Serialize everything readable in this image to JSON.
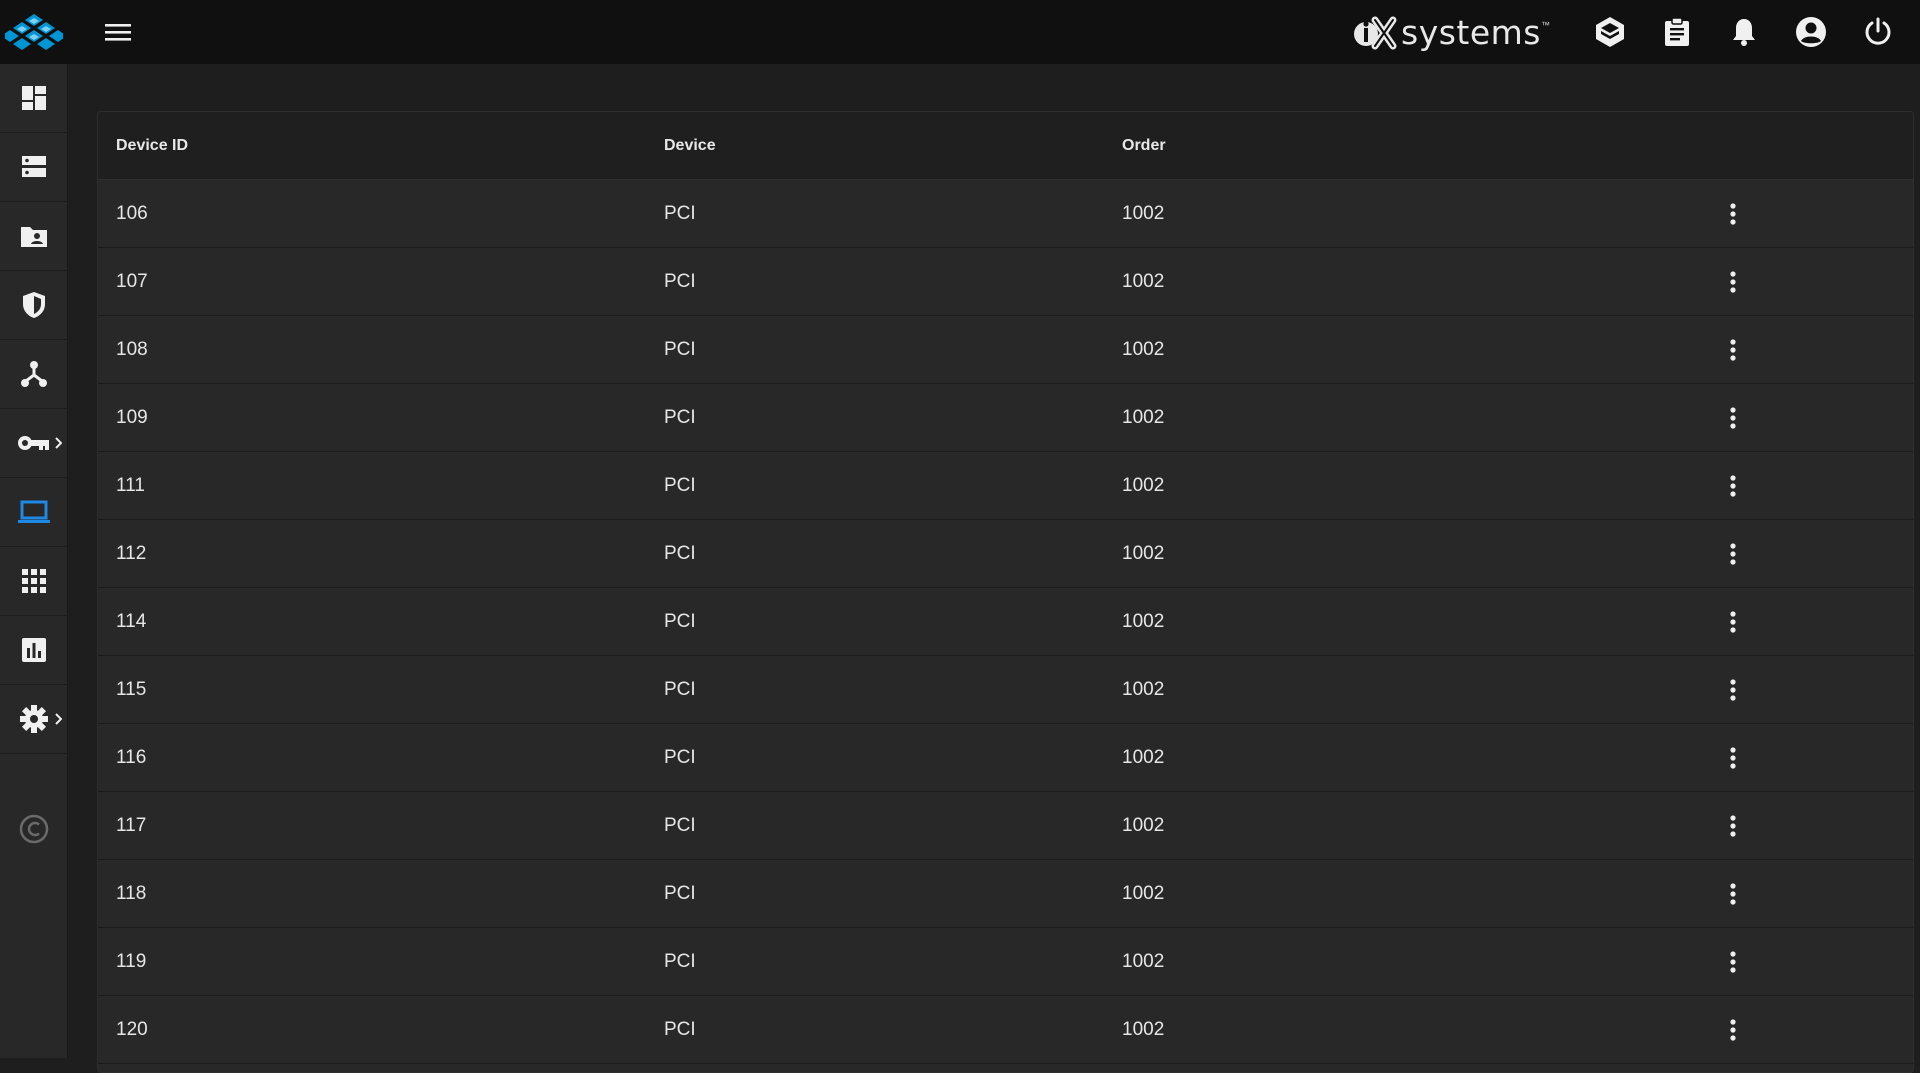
{
  "app": {
    "brand": "systems",
    "brand_tm": "™"
  },
  "colors": {
    "accent": "#1e88e5",
    "logo": "#0095d5"
  },
  "topbar": {
    "icons": [
      "truecommand-icon",
      "tasks-icon",
      "bell-icon",
      "account-icon",
      "power-icon"
    ]
  },
  "sidebar": {
    "items": [
      {
        "icon": "dashboard-icon",
        "active": false,
        "expandable": false
      },
      {
        "icon": "storage-icon",
        "active": false,
        "expandable": false
      },
      {
        "icon": "shares-icon",
        "active": false,
        "expandable": false
      },
      {
        "icon": "shield-icon",
        "active": false,
        "expandable": false
      },
      {
        "icon": "network-icon",
        "active": false,
        "expandable": false
      },
      {
        "icon": "key-icon",
        "active": false,
        "expandable": true
      },
      {
        "icon": "laptop-icon",
        "active": true,
        "expandable": false
      },
      {
        "icon": "apps-grid-icon",
        "active": false,
        "expandable": false
      },
      {
        "icon": "reporting-icon",
        "active": false,
        "expandable": false
      },
      {
        "icon": "gear-icon",
        "active": false,
        "expandable": true
      }
    ],
    "footer_icon": "copyright-icon"
  },
  "table": {
    "headers": {
      "device_id": "Device ID",
      "device": "Device",
      "order": "Order"
    },
    "rows": [
      {
        "device_id": "106",
        "device": "PCI",
        "order": "1002"
      },
      {
        "device_id": "107",
        "device": "PCI",
        "order": "1002"
      },
      {
        "device_id": "108",
        "device": "PCI",
        "order": "1002"
      },
      {
        "device_id": "109",
        "device": "PCI",
        "order": "1002"
      },
      {
        "device_id": "111",
        "device": "PCI",
        "order": "1002"
      },
      {
        "device_id": "112",
        "device": "PCI",
        "order": "1002"
      },
      {
        "device_id": "114",
        "device": "PCI",
        "order": "1002"
      },
      {
        "device_id": "115",
        "device": "PCI",
        "order": "1002"
      },
      {
        "device_id": "116",
        "device": "PCI",
        "order": "1002"
      },
      {
        "device_id": "117",
        "device": "PCI",
        "order": "1002"
      },
      {
        "device_id": "118",
        "device": "PCI",
        "order": "1002"
      },
      {
        "device_id": "119",
        "device": "PCI",
        "order": "1002"
      },
      {
        "device_id": "120",
        "device": "PCI",
        "order": "1002"
      }
    ]
  }
}
